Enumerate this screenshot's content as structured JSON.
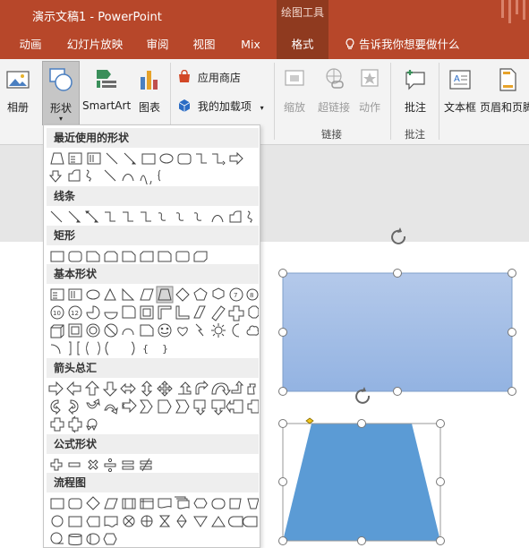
{
  "window": {
    "title": "演示文稿1 - PowerPoint",
    "context_tab_group": "绘图工具"
  },
  "tabs": [
    {
      "label": "动画"
    },
    {
      "label": "幻灯片放映"
    },
    {
      "label": "审阅"
    },
    {
      "label": "视图"
    },
    {
      "label": "Mix"
    },
    {
      "label": "格式",
      "active": true
    }
  ],
  "tell_me": "告诉我你想要做什么",
  "ribbon": {
    "album": "相册",
    "shapes": "形状",
    "smartart": "SmartArt",
    "chart": "图表",
    "app_store": "应用商店",
    "my_addins": "我的加载项",
    "zoom": "缩放",
    "hyperlink": "超链接",
    "action": "动作",
    "link_group": "链接",
    "comment": "批注",
    "comment_group": "批注",
    "textbox": "文本框",
    "header_footer": "页眉和页脚"
  },
  "shapes_menu": {
    "categories": [
      {
        "title": "最近使用的形状"
      },
      {
        "title": "线条"
      },
      {
        "title": "矩形"
      },
      {
        "title": "基本形状"
      },
      {
        "title": "箭头总汇"
      },
      {
        "title": "公式形状"
      },
      {
        "title": "流程图"
      }
    ]
  },
  "colors": {
    "brand": "#b7472a",
    "brand_dark": "#8f3a1f",
    "shape_fill_rect_top": "#b4c9ea",
    "shape_fill_rect_bottom": "#93b3e2",
    "shape_fill_trapezoid": "#5b9bd5"
  },
  "icons": [
    "picture-icon",
    "shapes-icon",
    "smartart-icon",
    "chart-icon",
    "store-icon",
    "addins-icon",
    "zoom-icon",
    "hyperlink-icon",
    "action-icon",
    "comment-icon",
    "textbox-icon",
    "header-footer-icon",
    "search-lightbulb-icon",
    "rotate-handle-icon"
  ]
}
